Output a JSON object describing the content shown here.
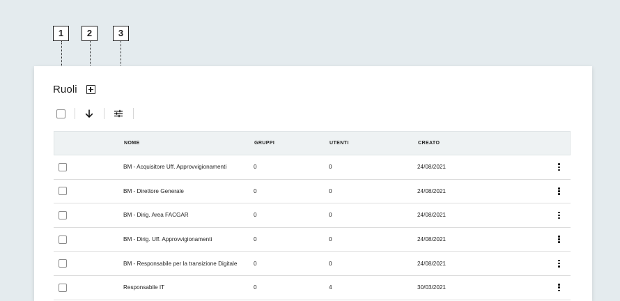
{
  "callouts": [
    "1",
    "2",
    "3"
  ],
  "header": {
    "title": "Ruoli"
  },
  "icons": {
    "add": "plus-square-icon",
    "select_all": "checkbox-icon",
    "sort": "arrow-down-icon",
    "filter": "sliders-icon",
    "row_menu": "kebab-menu-icon"
  },
  "table": {
    "columns": {
      "nome": "NOME",
      "gruppi": "GRUPPI",
      "utenti": "UTENTI",
      "creato": "CREATO"
    },
    "rows": [
      {
        "nome": "BM - Acquisitore Uff. Approvvigionamenti",
        "gruppi": "0",
        "utenti": "0",
        "creato": "24/08/2021"
      },
      {
        "nome": "BM - Direttore Generale",
        "gruppi": "0",
        "utenti": "0",
        "creato": "24/08/2021"
      },
      {
        "nome": "BM - Dirig. Area FACGAR",
        "gruppi": "0",
        "utenti": "0",
        "creato": "24/08/2021"
      },
      {
        "nome": "BM - Dirig. Uff. Approvvigionamenti",
        "gruppi": "0",
        "utenti": "0",
        "creato": "24/08/2021"
      },
      {
        "nome": "BM - Responsabile per la transizione Digitale",
        "gruppi": "0",
        "utenti": "0",
        "creato": "24/08/2021"
      },
      {
        "nome": "Responsabile IT",
        "gruppi": "0",
        "utenti": "4",
        "creato": "30/03/2021"
      }
    ]
  },
  "colors": {
    "page_background": "#e4ebee",
    "card_background": "#ffffff",
    "table_header_background": "#eef2f3",
    "text": "#1f1f1f"
  }
}
